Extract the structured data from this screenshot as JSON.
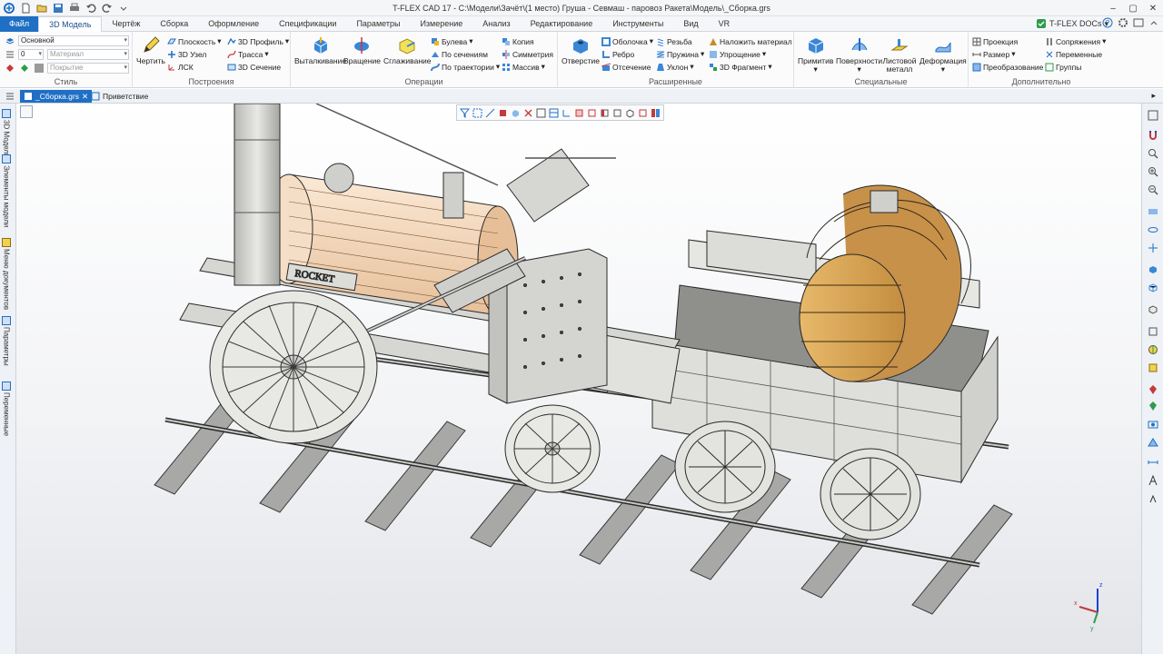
{
  "window": {
    "title": "T-FLEX CAD 17 - C:\\Модели\\Зачёт\\(1 место) Груша - Севмаш - паровоз Ракета\\Модель\\_Сборка.grs",
    "docs_label": "T-FLEX DOCs"
  },
  "quick_access": [
    "app-icon",
    "new-icon",
    "open-icon",
    "save-icon",
    "print-icon",
    "undo-icon",
    "redo-icon",
    "options-icon"
  ],
  "menu": {
    "file": "Файл",
    "tabs": [
      "3D Модель",
      "Чертёж",
      "Сборка",
      "Оформление",
      "Спецификации",
      "Параметры",
      "Измерение",
      "Анализ",
      "Редактирование",
      "Инструменты",
      "Вид",
      "VR"
    ]
  },
  "ribbon": {
    "style": {
      "label": "Стиль",
      "layer": "Основной",
      "level": "0",
      "material": "Материал",
      "coating": "Покрытие"
    },
    "build": {
      "label": "Построения",
      "draw": "Чертить",
      "plane": "Плоскость",
      "node3d": "3D Узел",
      "lcs": "ЛСК",
      "profile3d": "3D Профиль",
      "path": "Трасса",
      "section3d": "3D Сечение"
    },
    "ops": {
      "label": "Операции",
      "extrude": "Выталкивание",
      "rotate": "Вращение",
      "smooth": "Сглаживание",
      "boolean": "Булева",
      "by_sections": "По сечениям",
      "by_path": "По траектории",
      "copy": "Копия",
      "symmetry": "Симметрия",
      "array": "Массив"
    },
    "ext": {
      "label": "Расширенные",
      "hole": "Отверстие",
      "shell": "Оболочка",
      "rib": "Ребро",
      "cut": "Отсечение",
      "thread": "Резьба",
      "spring": "Пружина",
      "slope": "Уклон",
      "apply_material": "Наложить материал",
      "simplify": "Упрощение",
      "fragment3d": "3D Фрагмент"
    },
    "special": {
      "label": "Специальные",
      "primitive": "Примитив",
      "surfaces": "Поверхности",
      "sheet_metal": "Листовой металл",
      "deform": "Деформация"
    },
    "extra": {
      "label": "Дополнительно",
      "projection": "Проекция",
      "size": "Размер",
      "transform": "Преобразование",
      "mates": "Сопряжения",
      "variables": "Переменные",
      "groups": "Группы"
    }
  },
  "doc_tabs": [
    {
      "label": "_Сборка.grs",
      "active": true
    },
    {
      "label": "Приветствие",
      "active": false
    }
  ],
  "left_panel": [
    "3D Модель",
    "Элементы модели",
    "Меню документов",
    "Параметры",
    "Переменные"
  ],
  "colors": {
    "accent": "#1f6fc4",
    "barrel": "#d9a657",
    "boiler": "#f3dcc4",
    "metal": "#cfd0cc",
    "outline": "#2a2a2a"
  },
  "axes": {
    "x": "x",
    "y": "y",
    "z": "z"
  }
}
